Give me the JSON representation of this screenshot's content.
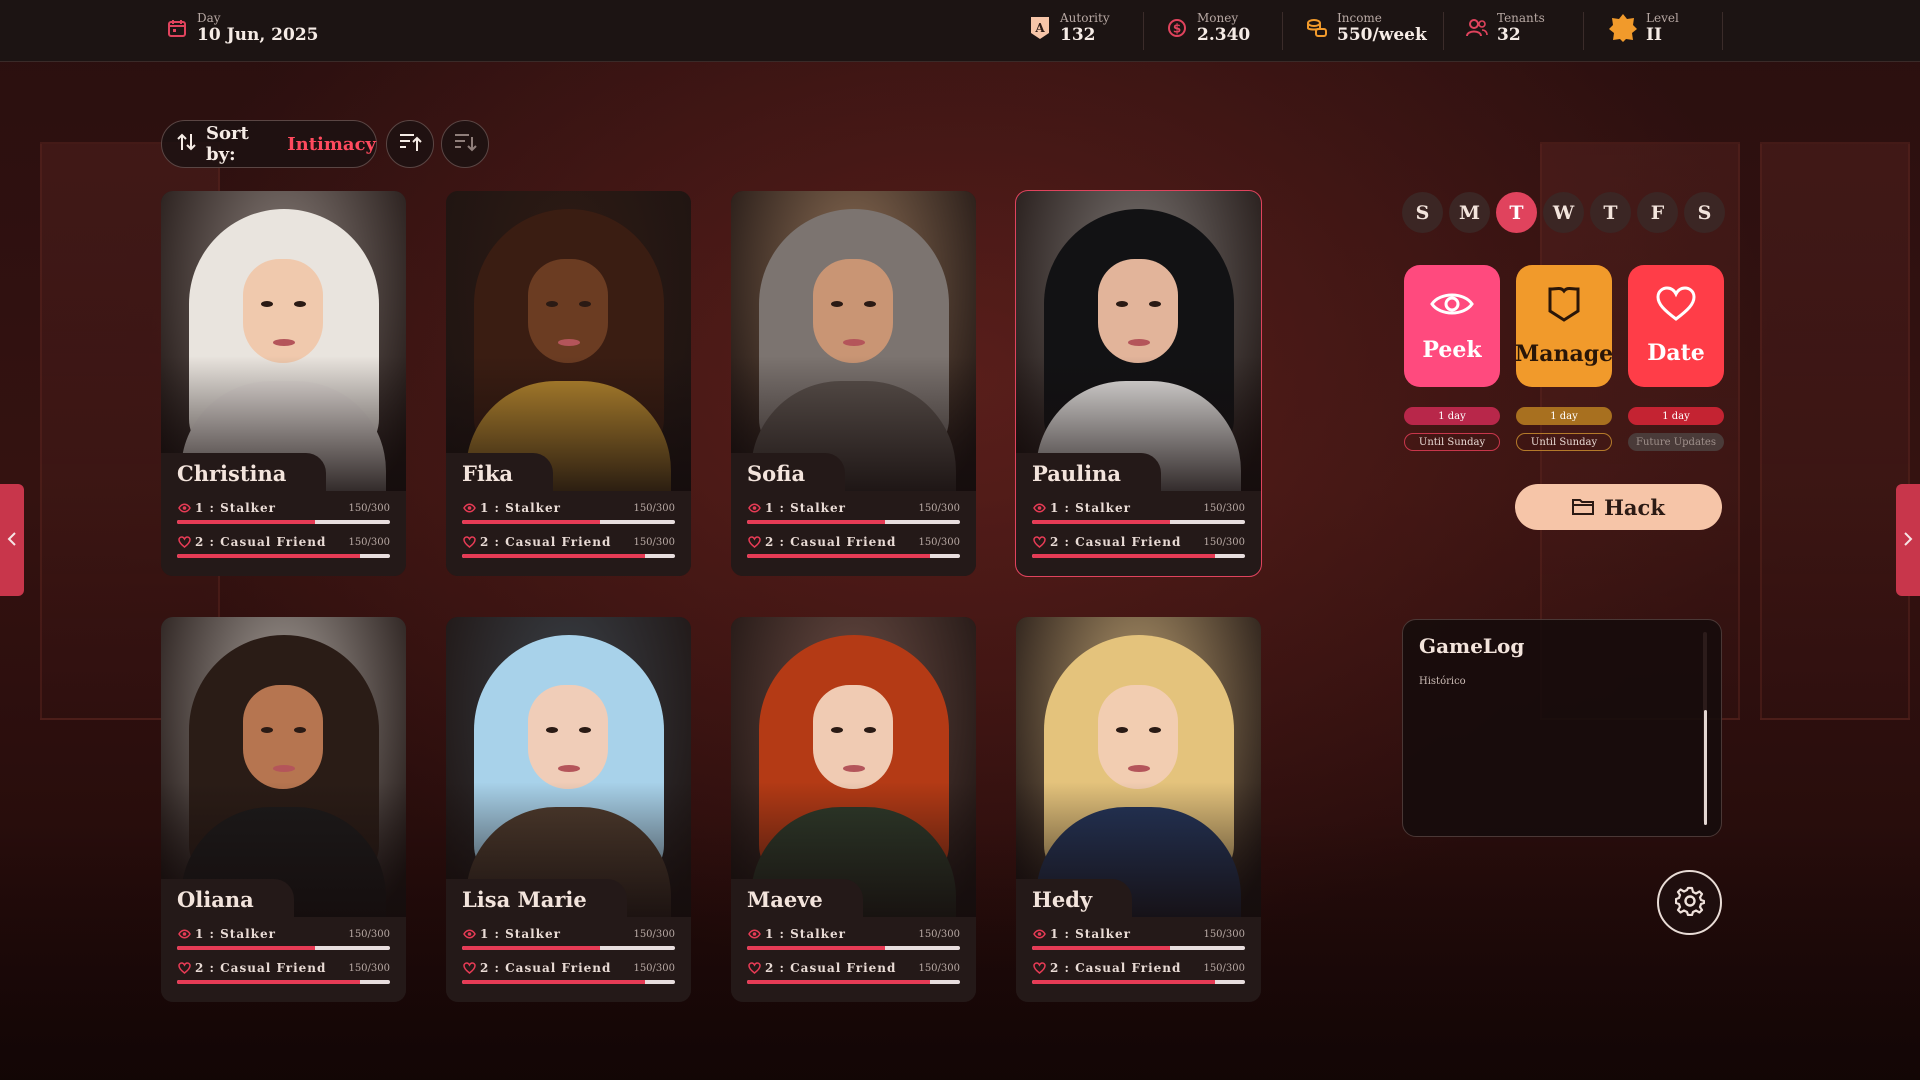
{
  "topbar": {
    "day": {
      "label": "Day",
      "value": "10 Jun, 2025",
      "icon": "calendar-icon"
    },
    "authority": {
      "label": "Autority",
      "value": "132",
      "icon": "authority-badge-icon"
    },
    "money": {
      "label": "Money",
      "value": "2.340",
      "icon": "dollar-coin-icon"
    },
    "income": {
      "label": "Income",
      "value": "550/week",
      "icon": "coins-stack-icon"
    },
    "tenants": {
      "label": "Tenants",
      "value": "32",
      "icon": "users-icon"
    },
    "level": {
      "label": "Level",
      "value": "II",
      "icon": "level-badge-icon"
    }
  },
  "sort": {
    "prefix": "Sort by:",
    "value": "Intimacy"
  },
  "cards": [
    {
      "name": "Christina",
      "r1": "1 : Stalker",
      "r1pts": "150/300",
      "r1pct": 0.65,
      "r2": "2 : Casual Friend",
      "r2pts": "150/300",
      "r2pct": 0.86,
      "hair": "#e9e4de",
      "skin": "#f0c9ad",
      "outfit": "#e6e0dc",
      "bg": "#8a7f7a"
    },
    {
      "name": "Fika",
      "r1": "1 : Stalker",
      "r1pts": "150/300",
      "r1pct": 0.65,
      "r2": "2 : Casual Friend",
      "r2pts": "150/300",
      "r2pct": 0.86,
      "hair": "#3a1d12",
      "skin": "#6b3c22",
      "outfit": "#b8892f",
      "bg": "#2e1b14"
    },
    {
      "name": "Sofia",
      "r1": "1 : Stalker",
      "r1pts": "150/300",
      "r1pct": 0.65,
      "r2": "2 : Casual Friend",
      "r2pts": "150/300",
      "r2pct": 0.86,
      "hair": "#7c7470",
      "skin": "#c99574",
      "outfit": "#5a514c",
      "bg": "#8c6e55"
    },
    {
      "name": "Paulina",
      "r1": "1 : Stalker",
      "r1pts": "150/300",
      "r1pct": 0.65,
      "r2": "2 : Casual Friend",
      "r2pts": "150/300",
      "r2pct": 0.86,
      "hair": "#121214",
      "skin": "#e2b49a",
      "outfit": "#e8e6e4",
      "bg": "#7c7673",
      "selected": true
    },
    {
      "name": "Oliana",
      "r1": "1 : Stalker",
      "r1pts": "150/300",
      "r1pct": 0.65,
      "r2": "2 : Casual Friend",
      "r2pts": "150/300",
      "r2pct": 0.86,
      "hair": "#2a1c16",
      "skin": "#b67550",
      "outfit": "#1c1a1a",
      "bg": "#a8a09a"
    },
    {
      "name": "Lisa Marie",
      "r1": "1 : Stalker",
      "r1pts": "150/300",
      "r1pct": 0.65,
      "r2": "2 : Casual Friend",
      "r2pts": "150/300",
      "r2pct": 0.86,
      "hair": "#a8d2ea",
      "skin": "#f0cdb8",
      "outfit": "#4e3b2d",
      "bg": "#3b4148"
    },
    {
      "name": "Maeve",
      "r1": "1 : Stalker",
      "r1pts": "150/300",
      "r1pct": 0.65,
      "r2": "2 : Casual Friend",
      "r2pts": "150/300",
      "r2pct": 0.86,
      "hair": "#b43a15",
      "skin": "#f0cbb3",
      "outfit": "#2e3a2a",
      "bg": "#6a4c44"
    },
    {
      "name": "Hedy",
      "r1": "1 : Stalker",
      "r1pts": "150/300",
      "r1pct": 0.65,
      "r2": "2 : Casual Friend",
      "r2pts": "150/300",
      "r2pct": 0.86,
      "hair": "#e4c37c",
      "skin": "#f2cdb1",
      "outfit": "#24355a",
      "bg": "#b59a6e"
    }
  ],
  "week": {
    "days": [
      "S",
      "M",
      "T",
      "W",
      "T",
      "F",
      "S"
    ],
    "active_index": 2
  },
  "actions": [
    {
      "label": "Peek",
      "icon": "eye-icon",
      "duration": "1 day",
      "availability": "Until Sunday"
    },
    {
      "label": "Manage",
      "icon": "shield-icon",
      "duration": "1 day",
      "availability": "Until Sunday"
    },
    {
      "label": "Date",
      "icon": "heart-icon",
      "duration": "1 day",
      "availability": "Future Updates"
    }
  ],
  "hack": {
    "label": "Hack",
    "icon": "folder-icon"
  },
  "gamelog": {
    "title": "GameLog",
    "subtitle": "Histórico"
  },
  "colors": {
    "accent": "#e0435d",
    "peek": "#ff4a7e",
    "manage": "#f19a2b",
    "date": "#ff3d48",
    "hack": "#f6c5a8"
  }
}
